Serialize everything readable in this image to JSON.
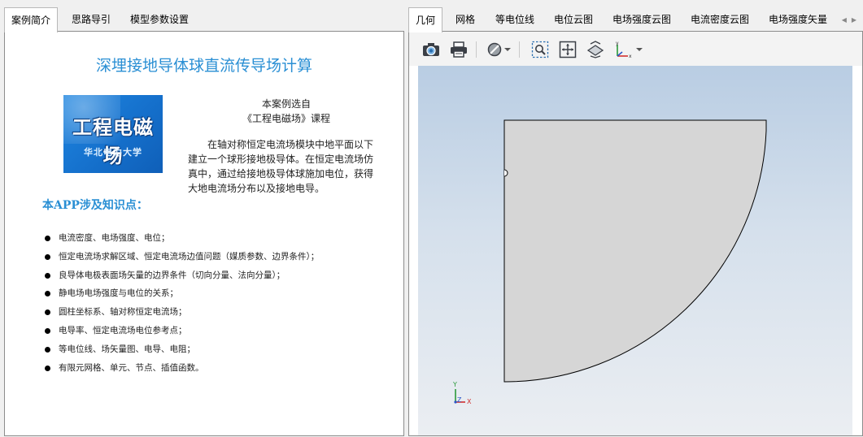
{
  "left": {
    "tabs": [
      {
        "label": "案例简介",
        "active": true
      },
      {
        "label": "思路导引",
        "active": false
      },
      {
        "label": "模型参数设置",
        "active": false
      }
    ],
    "title": "深埋接地导体球直流传导场计算",
    "logo": {
      "line1": "工程电磁场",
      "line2": "华北电力大学"
    },
    "intro": {
      "line1": "本案例选自",
      "line2": "《工程电磁场》课程",
      "paragraph": "在轴对称恒定电流场模块中地平面以下建立一个球形接地极导体。在恒定电流场仿真中，通过给接地极导体球施加电位，获得大地电流场分布以及接地电导。"
    },
    "knowledge_heading": "本APP涉及知识点：",
    "knowledge_points": [
      "电流密度、电场强度、电位；",
      "恒定电流场求解区域、恒定电流场边值问题（媒质参数、边界条件）；",
      "良导体电极表面场矢量的边界条件（切向分量、法向分量）；",
      "静电场电场强度与电位的关系；",
      "圆柱坐标系、轴对称恒定电流场；",
      "电导率、恒定电流场电位参考点；",
      "等电位线、场矢量图、电导、电阻；",
      "有限元网格、单元、节点、插值函数。"
    ]
  },
  "right": {
    "tabs": [
      {
        "label": "几何",
        "active": true
      },
      {
        "label": "网格",
        "active": false
      },
      {
        "label": "等电位线",
        "active": false
      },
      {
        "label": "电位云图",
        "active": false
      },
      {
        "label": "电场强度云图",
        "active": false
      },
      {
        "label": "电流密度云图",
        "active": false
      },
      {
        "label": "电场强度矢量",
        "active": false
      }
    ],
    "toolbar_icons": [
      "camera-icon",
      "printer-icon",
      "hide-icon",
      "zoom-box-icon",
      "zoom-extents-icon",
      "transparency-icon",
      "axis-orientation-icon"
    ],
    "triad": {
      "y": "Y",
      "z": "Z",
      "x": "X"
    },
    "colors": {
      "geometry_fill": "#d6d6d6",
      "triad_x": "#d0302f",
      "triad_y": "#2a9a3a",
      "triad_z": "#2a55c8"
    }
  }
}
